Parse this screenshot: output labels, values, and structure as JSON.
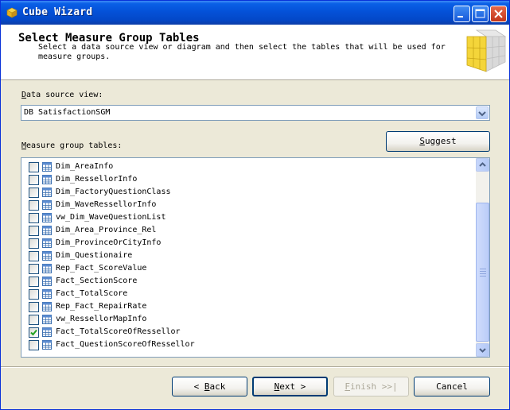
{
  "window": {
    "title": "Cube Wizard"
  },
  "header": {
    "title": "Select Measure Group Tables",
    "description": "Select a data source view or diagram and then select the tables that will be used for measure groups."
  },
  "data_source": {
    "label_hotkey": "D",
    "label_rest": "ata source view:",
    "selected_value": "DB SatisfactionSGM"
  },
  "measure_tables": {
    "label_hotkey": "M",
    "label_rest": "easure group tables:",
    "suggest_hotkey": "S",
    "suggest_rest": "uggest",
    "items": [
      {
        "name": "Dim_AreaInfo",
        "checked": false
      },
      {
        "name": "Dim_RessellorInfo",
        "checked": false
      },
      {
        "name": "Dim_FactoryQuestionClass",
        "checked": false
      },
      {
        "name": "Dim_WaveRessellorInfo",
        "checked": false
      },
      {
        "name": "vw_Dim_WaveQuestionList",
        "checked": false
      },
      {
        "name": "Dim_Area_Province_Rel",
        "checked": false
      },
      {
        "name": "Dim_ProvinceOrCityInfo",
        "checked": false
      },
      {
        "name": "Dim_Questionaire",
        "checked": false
      },
      {
        "name": "Rep_Fact_ScoreValue",
        "checked": false
      },
      {
        "name": "Fact_SectionScore",
        "checked": false
      },
      {
        "name": "Fact_TotalScore",
        "checked": false
      },
      {
        "name": "Rep_Fact_RepairRate",
        "checked": false
      },
      {
        "name": "vw_RessellorMapInfo",
        "checked": false
      },
      {
        "name": "Fact_TotalScoreOfRessellor",
        "checked": true
      },
      {
        "name": "Fact_QuestionScoreOfRessellor",
        "checked": false
      }
    ]
  },
  "footer": {
    "back_arrow": "<",
    "back_hotkey": "B",
    "back_rest": "ack",
    "next_hotkey": "N",
    "next_rest": "ext",
    "next_arrow": ">",
    "finish_hotkey": "F",
    "finish_rest": "inish >>|",
    "cancel_label": "Cancel"
  },
  "colors": {
    "titlebar": "#0451d8",
    "dialog_bg": "#ece9d8",
    "accent_check": "#21a121"
  }
}
